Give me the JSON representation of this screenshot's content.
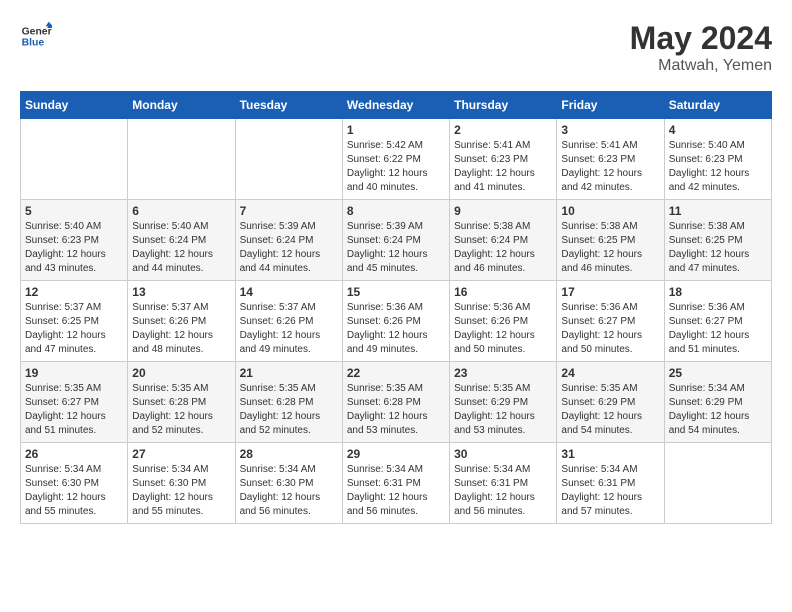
{
  "header": {
    "logo_line1": "General",
    "logo_line2": "Blue",
    "month_year": "May 2024",
    "location": "Matwah, Yemen"
  },
  "days_of_week": [
    "Sunday",
    "Monday",
    "Tuesday",
    "Wednesday",
    "Thursday",
    "Friday",
    "Saturday"
  ],
  "weeks": [
    [
      {
        "day": "",
        "sunrise": "",
        "sunset": "",
        "daylight": ""
      },
      {
        "day": "",
        "sunrise": "",
        "sunset": "",
        "daylight": ""
      },
      {
        "day": "",
        "sunrise": "",
        "sunset": "",
        "daylight": ""
      },
      {
        "day": "1",
        "sunrise": "Sunrise: 5:42 AM",
        "sunset": "Sunset: 6:22 PM",
        "daylight": "Daylight: 12 hours and 40 minutes."
      },
      {
        "day": "2",
        "sunrise": "Sunrise: 5:41 AM",
        "sunset": "Sunset: 6:23 PM",
        "daylight": "Daylight: 12 hours and 41 minutes."
      },
      {
        "day": "3",
        "sunrise": "Sunrise: 5:41 AM",
        "sunset": "Sunset: 6:23 PM",
        "daylight": "Daylight: 12 hours and 42 minutes."
      },
      {
        "day": "4",
        "sunrise": "Sunrise: 5:40 AM",
        "sunset": "Sunset: 6:23 PM",
        "daylight": "Daylight: 12 hours and 42 minutes."
      }
    ],
    [
      {
        "day": "5",
        "sunrise": "Sunrise: 5:40 AM",
        "sunset": "Sunset: 6:23 PM",
        "daylight": "Daylight: 12 hours and 43 minutes."
      },
      {
        "day": "6",
        "sunrise": "Sunrise: 5:40 AM",
        "sunset": "Sunset: 6:24 PM",
        "daylight": "Daylight: 12 hours and 44 minutes."
      },
      {
        "day": "7",
        "sunrise": "Sunrise: 5:39 AM",
        "sunset": "Sunset: 6:24 PM",
        "daylight": "Daylight: 12 hours and 44 minutes."
      },
      {
        "day": "8",
        "sunrise": "Sunrise: 5:39 AM",
        "sunset": "Sunset: 6:24 PM",
        "daylight": "Daylight: 12 hours and 45 minutes."
      },
      {
        "day": "9",
        "sunrise": "Sunrise: 5:38 AM",
        "sunset": "Sunset: 6:24 PM",
        "daylight": "Daylight: 12 hours and 46 minutes."
      },
      {
        "day": "10",
        "sunrise": "Sunrise: 5:38 AM",
        "sunset": "Sunset: 6:25 PM",
        "daylight": "Daylight: 12 hours and 46 minutes."
      },
      {
        "day": "11",
        "sunrise": "Sunrise: 5:38 AM",
        "sunset": "Sunset: 6:25 PM",
        "daylight": "Daylight: 12 hours and 47 minutes."
      }
    ],
    [
      {
        "day": "12",
        "sunrise": "Sunrise: 5:37 AM",
        "sunset": "Sunset: 6:25 PM",
        "daylight": "Daylight: 12 hours and 47 minutes."
      },
      {
        "day": "13",
        "sunrise": "Sunrise: 5:37 AM",
        "sunset": "Sunset: 6:26 PM",
        "daylight": "Daylight: 12 hours and 48 minutes."
      },
      {
        "day": "14",
        "sunrise": "Sunrise: 5:37 AM",
        "sunset": "Sunset: 6:26 PM",
        "daylight": "Daylight: 12 hours and 49 minutes."
      },
      {
        "day": "15",
        "sunrise": "Sunrise: 5:36 AM",
        "sunset": "Sunset: 6:26 PM",
        "daylight": "Daylight: 12 hours and 49 minutes."
      },
      {
        "day": "16",
        "sunrise": "Sunrise: 5:36 AM",
        "sunset": "Sunset: 6:26 PM",
        "daylight": "Daylight: 12 hours and 50 minutes."
      },
      {
        "day": "17",
        "sunrise": "Sunrise: 5:36 AM",
        "sunset": "Sunset: 6:27 PM",
        "daylight": "Daylight: 12 hours and 50 minutes."
      },
      {
        "day": "18",
        "sunrise": "Sunrise: 5:36 AM",
        "sunset": "Sunset: 6:27 PM",
        "daylight": "Daylight: 12 hours and 51 minutes."
      }
    ],
    [
      {
        "day": "19",
        "sunrise": "Sunrise: 5:35 AM",
        "sunset": "Sunset: 6:27 PM",
        "daylight": "Daylight: 12 hours and 51 minutes."
      },
      {
        "day": "20",
        "sunrise": "Sunrise: 5:35 AM",
        "sunset": "Sunset: 6:28 PM",
        "daylight": "Daylight: 12 hours and 52 minutes."
      },
      {
        "day": "21",
        "sunrise": "Sunrise: 5:35 AM",
        "sunset": "Sunset: 6:28 PM",
        "daylight": "Daylight: 12 hours and 52 minutes."
      },
      {
        "day": "22",
        "sunrise": "Sunrise: 5:35 AM",
        "sunset": "Sunset: 6:28 PM",
        "daylight": "Daylight: 12 hours and 53 minutes."
      },
      {
        "day": "23",
        "sunrise": "Sunrise: 5:35 AM",
        "sunset": "Sunset: 6:29 PM",
        "daylight": "Daylight: 12 hours and 53 minutes."
      },
      {
        "day": "24",
        "sunrise": "Sunrise: 5:35 AM",
        "sunset": "Sunset: 6:29 PM",
        "daylight": "Daylight: 12 hours and 54 minutes."
      },
      {
        "day": "25",
        "sunrise": "Sunrise: 5:34 AM",
        "sunset": "Sunset: 6:29 PM",
        "daylight": "Daylight: 12 hours and 54 minutes."
      }
    ],
    [
      {
        "day": "26",
        "sunrise": "Sunrise: 5:34 AM",
        "sunset": "Sunset: 6:30 PM",
        "daylight": "Daylight: 12 hours and 55 minutes."
      },
      {
        "day": "27",
        "sunrise": "Sunrise: 5:34 AM",
        "sunset": "Sunset: 6:30 PM",
        "daylight": "Daylight: 12 hours and 55 minutes."
      },
      {
        "day": "28",
        "sunrise": "Sunrise: 5:34 AM",
        "sunset": "Sunset: 6:30 PM",
        "daylight": "Daylight: 12 hours and 56 minutes."
      },
      {
        "day": "29",
        "sunrise": "Sunrise: 5:34 AM",
        "sunset": "Sunset: 6:31 PM",
        "daylight": "Daylight: 12 hours and 56 minutes."
      },
      {
        "day": "30",
        "sunrise": "Sunrise: 5:34 AM",
        "sunset": "Sunset: 6:31 PM",
        "daylight": "Daylight: 12 hours and 56 minutes."
      },
      {
        "day": "31",
        "sunrise": "Sunrise: 5:34 AM",
        "sunset": "Sunset: 6:31 PM",
        "daylight": "Daylight: 12 hours and 57 minutes."
      },
      {
        "day": "",
        "sunrise": "",
        "sunset": "",
        "daylight": ""
      }
    ]
  ]
}
